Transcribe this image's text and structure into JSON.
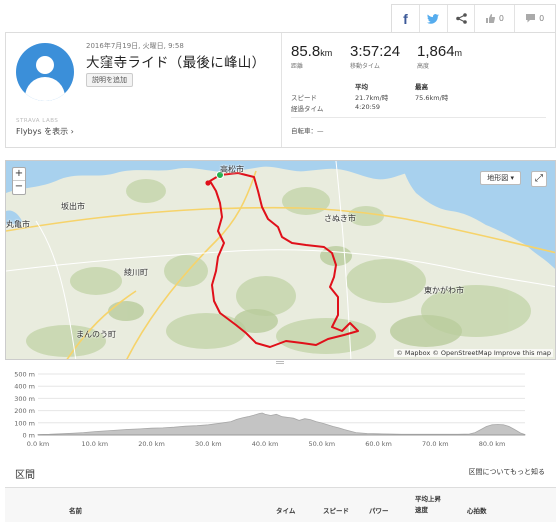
{
  "share": {
    "facebook_icon": "facebook-icon",
    "twitter_icon": "twitter-icon",
    "share_icon": "share-icon",
    "kudos_count": "0",
    "comment_count": "0"
  },
  "activity": {
    "date": "2016年7月19日, 火曜日, 9:58",
    "title": "大窪寺ライド（最後に峰山）",
    "add_description": "説明を追加",
    "strava_labs": "STRAVA LABS",
    "flybys": "Flybys を表示 ›"
  },
  "stats": {
    "distance": "85.8",
    "distance_unit": "km",
    "distance_label": "距離",
    "moving_time": "3:57:24",
    "moving_time_label": "移動タイム",
    "elevation": "1,864",
    "elevation_unit": "m",
    "elevation_label": "高度"
  },
  "details": {
    "avg_header": "平均",
    "max_header": "最高",
    "speed_label": "スピード",
    "speed_avg": "21.7km/時",
    "speed_max": "75.6km/時",
    "elapsed_label": "経過タイム",
    "elapsed_value": "4:20:59",
    "bike_label": "自転車：—"
  },
  "map": {
    "zoom_in": "+",
    "zoom_out": "−",
    "layer_select": "地形図 ▾",
    "fullscreen": "⤢",
    "attribution": "© Mapbox © OpenStreetMap Improve this map",
    "places": {
      "takamatsu": "高松市",
      "sakaide": "坂出市",
      "marugame": "丸亀市",
      "sanuki": "さぬき市",
      "higashikagawa": "東かがわ市",
      "ayagawa": "綾川町",
      "manno": "まんのう町"
    },
    "colors": {
      "water": "#a8d1ee",
      "land": "#e9ecde",
      "route": "#e0101a",
      "start": "#22b14c"
    }
  },
  "elevation_profile": {
    "y_ticks": [
      "500 m",
      "400 m",
      "300 m",
      "200 m",
      "100 m",
      "0 m"
    ],
    "x_ticks": [
      "0.0 km",
      "10.0 km",
      "20.0 km",
      "30.0 km",
      "40.0 km",
      "50.0 km",
      "60.0 km",
      "70.0 km",
      "80.0 km"
    ]
  },
  "segments": {
    "heading": "区間",
    "link": "区間についてもっと知る",
    "columns": {
      "name": "名前",
      "time": "タイム",
      "speed": "スピード",
      "power": "パワー",
      "avg_grade": "平均上昇速度",
      "heart_rate": "心拍数"
    }
  }
}
